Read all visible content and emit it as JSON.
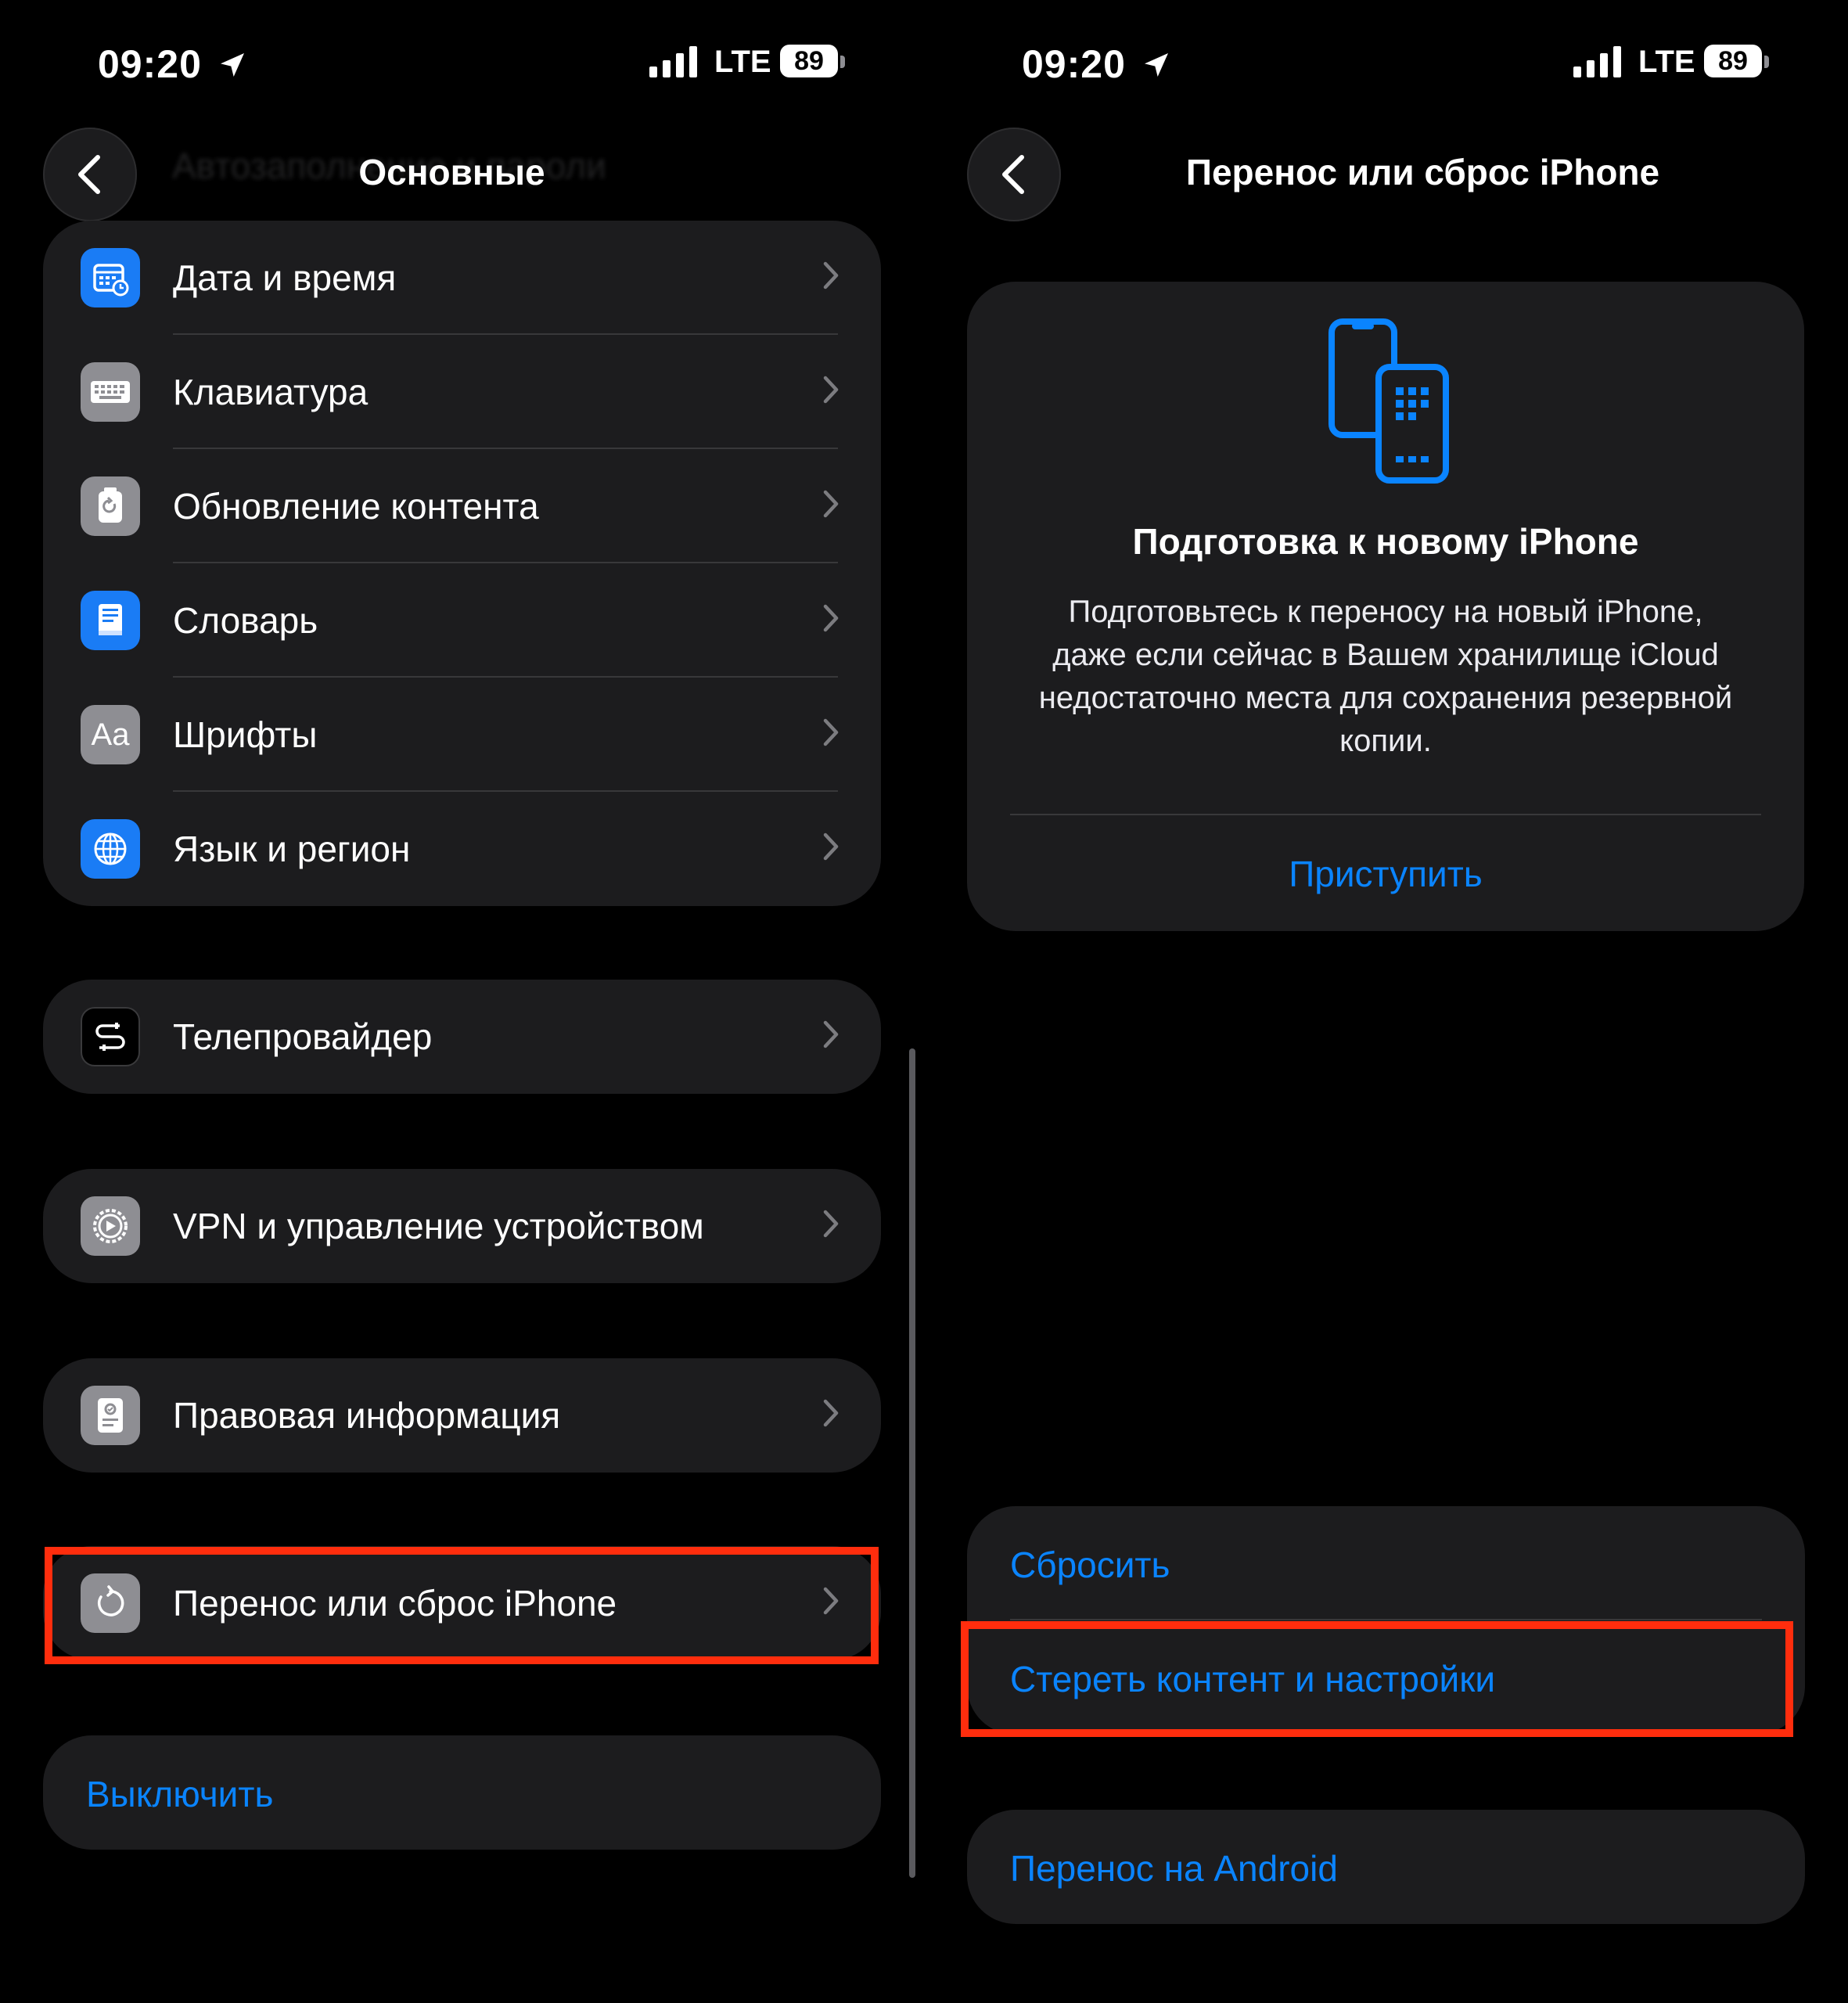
{
  "status": {
    "time": "09:20",
    "network": "LTE",
    "battery": "89"
  },
  "left": {
    "title": "Основные",
    "ghost_row": "Автозаполнение и пароли",
    "group1": [
      {
        "label": "Дата и время",
        "icon": "calendar-clock-icon"
      },
      {
        "label": "Клавиатура",
        "icon": "keyboard-icon"
      },
      {
        "label": "Обновление контента",
        "icon": "background-refresh-icon"
      },
      {
        "label": "Словарь",
        "icon": "dictionary-icon"
      },
      {
        "label": "Шрифты",
        "icon": "fonts-icon",
        "glyph": "Aa"
      },
      {
        "label": "Язык и регион",
        "icon": "globe-icon"
      }
    ],
    "tv_provider": "Телепровайдер",
    "vpn": "VPN и управление устройством",
    "legal": "Правовая информация",
    "transfer": "Перенос или сброс iPhone",
    "shutdown": "Выключить"
  },
  "right": {
    "title": "Перенос или сброс iPhone",
    "card": {
      "heading": "Подготовка к новому iPhone",
      "description": "Подготовьтесь к переносу на новый iPhone, даже если сейчас в Вашем хранилище iCloud недостаточно места для сохранения резервной копии.",
      "action": "Приступить"
    },
    "reset": "Сбросить",
    "erase": "Стереть контент и настройки",
    "android": "Перенос на Android"
  },
  "colors": {
    "accent": "#0a84ff",
    "highlight": "#ff2d0d",
    "cell": "#1c1c1e"
  }
}
